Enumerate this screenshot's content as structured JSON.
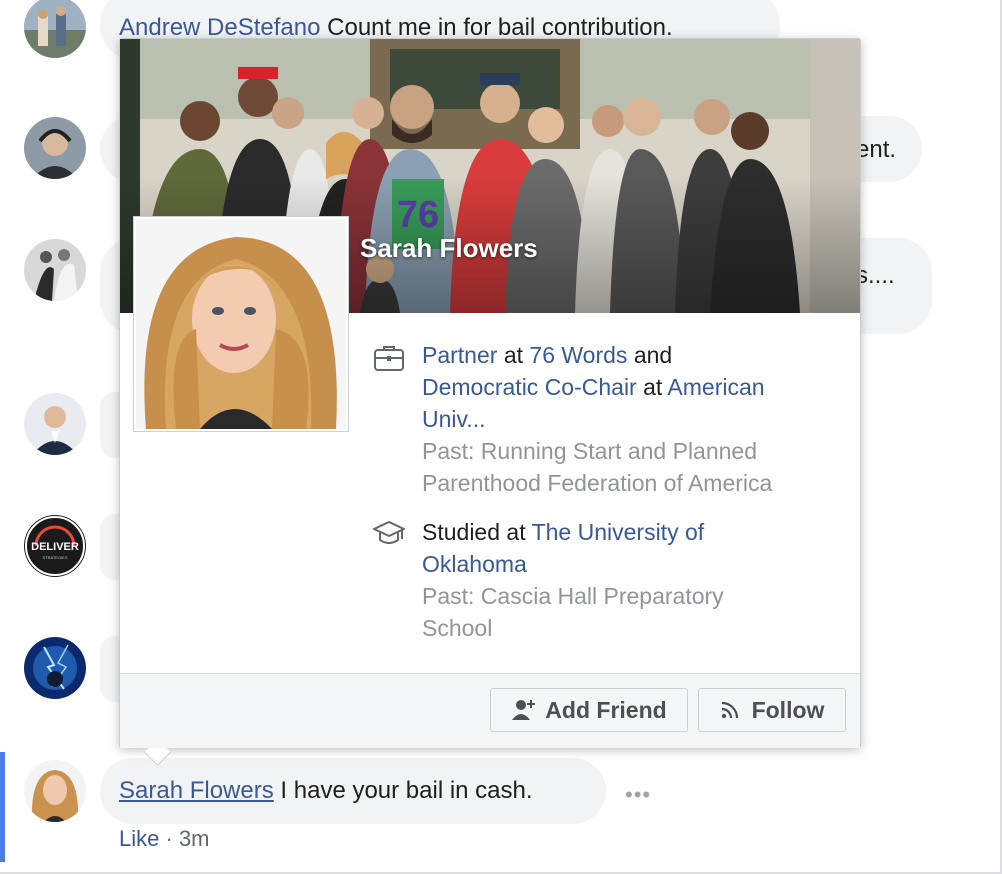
{
  "comments": [
    {
      "author": "Andrew DeStefano",
      "text": "Count me in for bail contribution."
    },
    {
      "author": "",
      "text": "ent."
    },
    {
      "author": "",
      "text": "s...."
    },
    {
      "author": "Sarah Flowers",
      "text": "I have your bail in cash."
    }
  ],
  "avatars": {
    "deliver_text": "DELIVER",
    "deliver_sub": "STRATEGIES"
  },
  "footer": {
    "like_label": "Like",
    "separator": "·",
    "time": "3m"
  },
  "hovercard": {
    "name": "Sarah Flowers",
    "cover_sign": "76",
    "work": {
      "role1": "Partner",
      "at1": "at",
      "org1": "76 Words",
      "and": "and",
      "role2": "Democratic Co-Chair",
      "at2": "at",
      "org2_line1": "American",
      "org2_line2": "Univ...",
      "past_line1": "Past: Running Start and Planned",
      "past_line2": "Parenthood Federation of America"
    },
    "education": {
      "studied": "Studied at",
      "school_line1": "The University of",
      "school_line2": "Oklahoma",
      "past_line1": "Past: Cascia Hall Preparatory",
      "past_line2": "School"
    },
    "buttons": {
      "add_friend": "Add Friend",
      "follow": "Follow"
    }
  },
  "colors": {
    "link": "#385898",
    "bubble": "#f2f3f5",
    "highlight": "#4a7fe0"
  }
}
